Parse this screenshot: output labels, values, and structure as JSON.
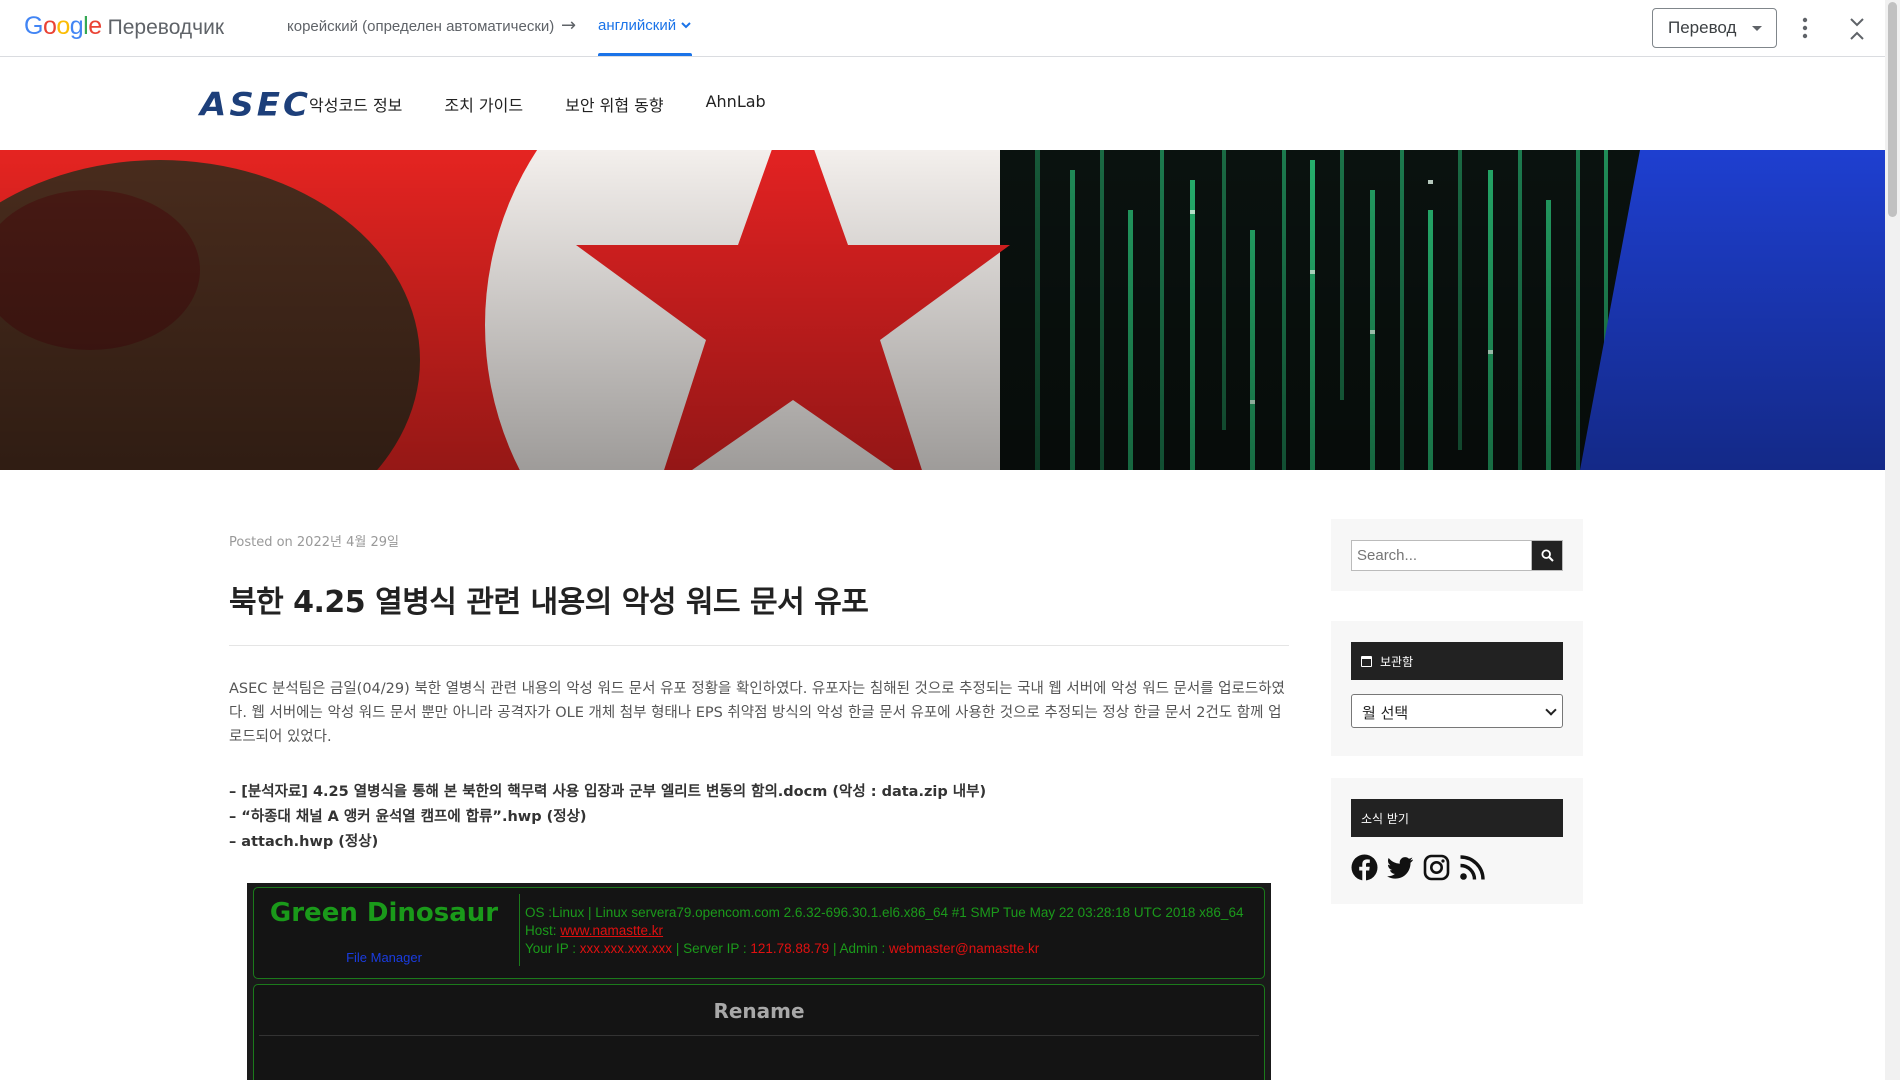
{
  "translate_bar": {
    "logo_text": "Google",
    "brand": "Переводчик",
    "source_language": "корейский (определен автоматически)",
    "arrow": "→",
    "target_language": "английский",
    "translate_select_label": "Перевод",
    "colors": {
      "blue": "#4285F4",
      "red": "#EA4335",
      "yellow": "#FBBC05",
      "green": "#34A853",
      "accent": "#1a73e8"
    }
  },
  "site": {
    "logo": "ASEC",
    "nav": [
      "악성코드 정보",
      "조치 가이드",
      "보안 위협 동향",
      "AhnLab"
    ]
  },
  "post": {
    "meta": "Posted on 2022년 4월 29일",
    "title": "북한 4.25 열병식 관련 내용의 악성 워드 문서 유포",
    "paragraph": "ASEC 분석팀은 금일(04/29) 북한 열병식 관련 내용의 악성 워드 문서 유포 정황을 확인하였다. 유포자는 침해된 것으로 추정되는 국내 웹 서버에 악성 워드 문서를 업로드하였다. 웹 서버에는 악성 워드 문서 뿐만 아니라 공격자가 OLE 개체 첨부 형태나 EPS 취약점 방식의 악성 한글 문서 유포에 사용한 것으로 추정되는 정상 한글 문서 2건도 함께 업로드되어 있었다.",
    "files": [
      "– [분석자료] 4.25 열병식을 통해 본 북한의 핵무력 사용 입장과 군부 엘리트 변동의 함의.docm (악성 : data.zip 내부)",
      "– “하종대 채널 A 앵커 윤석열 캠프에 합류”.hwp (정상)",
      "– attach.hwp (정상)"
    ]
  },
  "shell": {
    "brand": "Green Dinosaur",
    "file_manager": "File Manager",
    "os_line": "OS :Linux | Linux servera79.opencom.com 2.6.32-696.30.1.el6.x86_64 #1 SMP Tue May 22 03:28:18 UTC 2018 x86_64",
    "host_label": "Host: ",
    "host_link": "www.namastte.kr",
    "your_ip_label": "Your IP : ",
    "your_ip": "xxx.xxx.xxx.xxx",
    "server_ip_label": " | Server IP : ",
    "server_ip": "121.78.88.79",
    "admin_label": " | Admin : ",
    "admin": "webmaster@namastte.kr",
    "rename_title": "Rename"
  },
  "sidebar": {
    "search_placeholder": "Search...",
    "archive_title": "보관함",
    "archive_select": "월 선택",
    "social_title": "소식 받기",
    "social_icons": [
      "facebook-icon",
      "twitter-icon",
      "instagram-icon",
      "rss-icon"
    ]
  }
}
